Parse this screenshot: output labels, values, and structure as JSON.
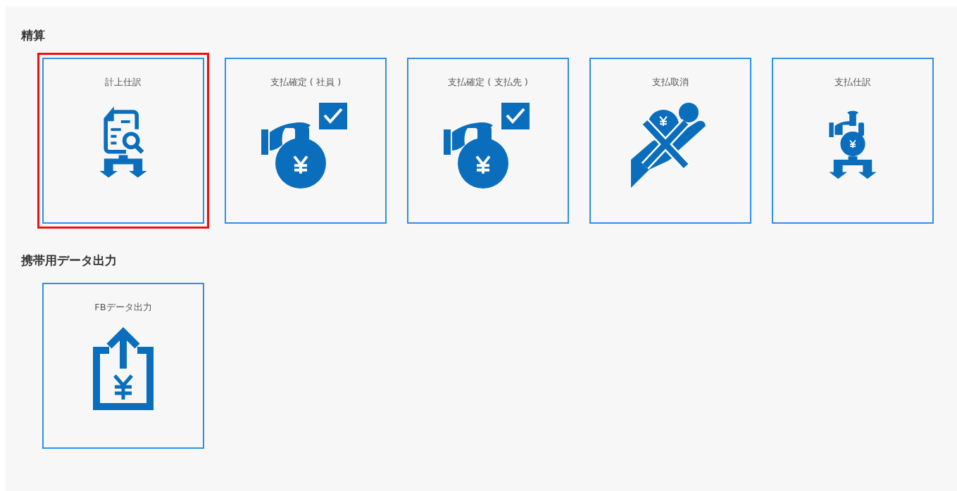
{
  "sections": [
    {
      "title": "精算",
      "tiles": [
        {
          "label": "計上仕訳",
          "kind": "ledger",
          "selected": true
        },
        {
          "label": "支払確定 ( 社員 )",
          "kind": "bag-check",
          "selected": false
        },
        {
          "label": "支払確定 ( 支払先 )",
          "kind": "bag-check",
          "selected": false
        },
        {
          "label": "支払取消",
          "kind": "cancel",
          "selected": false
        },
        {
          "label": "支払仕訳",
          "kind": "bag-split",
          "selected": false
        }
      ]
    },
    {
      "title": "携帯用データ出力",
      "tiles": [
        {
          "label": "FBデータ出力",
          "kind": "upload",
          "selected": false
        }
      ]
    }
  ]
}
